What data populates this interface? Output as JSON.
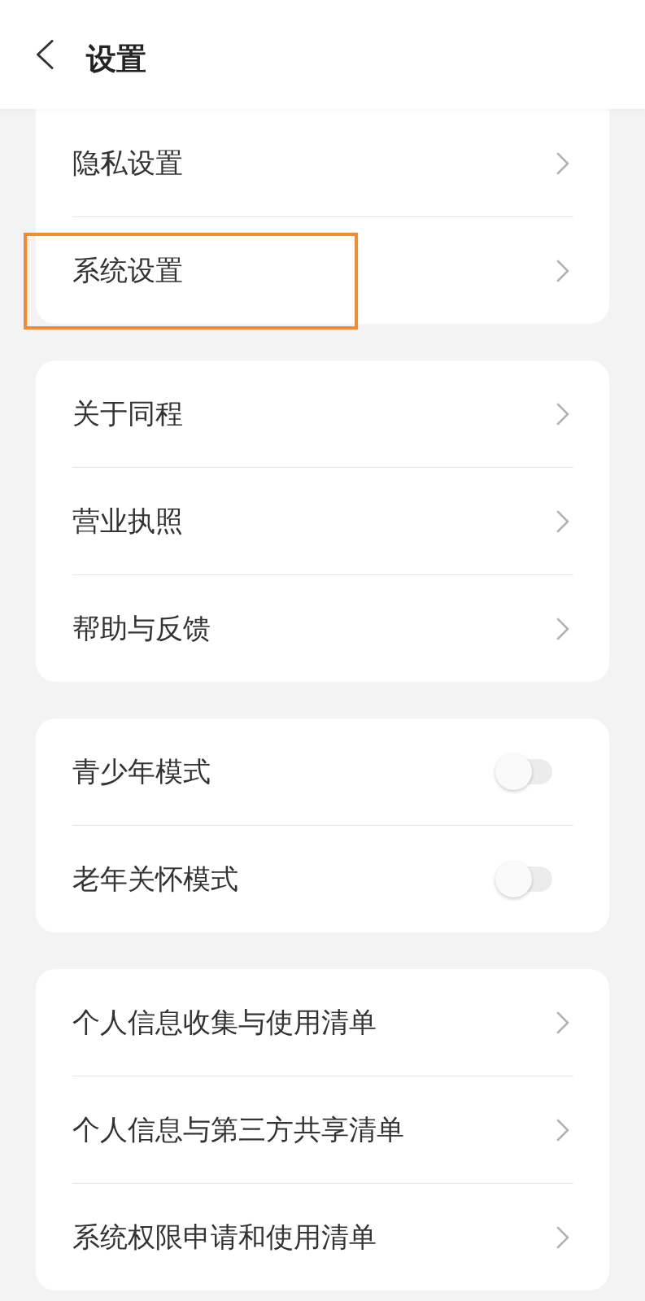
{
  "header": {
    "title": "设置"
  },
  "groups": [
    {
      "items": [
        {
          "kind": "link",
          "label": "隐私设置",
          "highlighted": false
        },
        {
          "kind": "link",
          "label": "系统设置",
          "highlighted": true
        }
      ]
    },
    {
      "items": [
        {
          "kind": "link",
          "label": "关于同程",
          "highlighted": false
        },
        {
          "kind": "link",
          "label": "营业执照",
          "highlighted": false
        },
        {
          "kind": "link",
          "label": "帮助与反馈",
          "highlighted": false
        }
      ]
    },
    {
      "items": [
        {
          "kind": "toggle",
          "label": "青少年模式",
          "on": false,
          "highlighted": false
        },
        {
          "kind": "toggle",
          "label": "老年关怀模式",
          "on": false,
          "highlighted": false
        }
      ]
    },
    {
      "items": [
        {
          "kind": "link",
          "label": "个人信息收集与使用清单",
          "highlighted": false
        },
        {
          "kind": "link",
          "label": "个人信息与第三方共享清单",
          "highlighted": false
        },
        {
          "kind": "link",
          "label": "系统权限申请和使用清单",
          "highlighted": false
        }
      ]
    }
  ]
}
